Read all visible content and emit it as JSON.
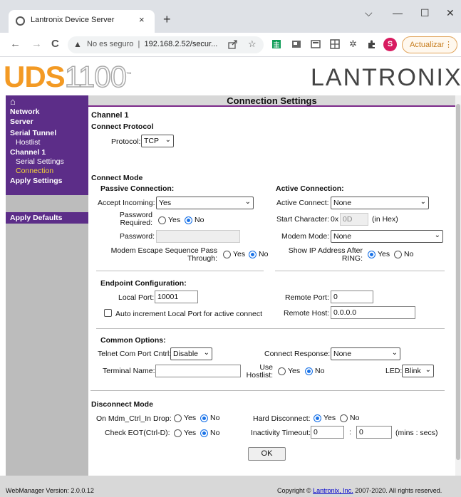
{
  "browser": {
    "tab_title": "Lantronix Device Server",
    "tab_close": "×",
    "new_tab": "+",
    "win_min": "—",
    "win_max": "☐",
    "win_close": "✕",
    "win_chev": "⌵",
    "back": "←",
    "forward": "→",
    "reload": "C",
    "warn": "▲",
    "security_text": "No es seguro",
    "url": "192.168.2.52/secur...",
    "avatar": "S",
    "update_label": "Actualizar",
    "menu": "⋮"
  },
  "banner": {
    "model_prefix": "UDS",
    "model_num": "1100",
    "brand": "LANTRONIX"
  },
  "sidebar": {
    "home_icon": "⌂",
    "items": [
      "Network",
      "Server",
      "Serial Tunnel",
      "Hostlist",
      "Channel 1",
      "Serial Settings",
      "Connection",
      "Apply Settings"
    ],
    "apply_defaults": "Apply Defaults"
  },
  "page": {
    "title": "Connection Settings",
    "channel": "Channel 1",
    "connect_protocol": "Connect Protocol",
    "protocol_label": "Protocol:",
    "protocol_value": "TCP",
    "connect_mode": "Connect Mode",
    "passive": "Passive Connection:",
    "active": "Active Connection:",
    "accept_incoming_label": "Accept Incoming:",
    "accept_incoming_value": "Yes",
    "password_required_l1": "Password",
    "password_required_l2": "Required:",
    "password_label": "Password:",
    "password_value": "",
    "modem_escape_l1": "Modem Escape Sequence Pass",
    "modem_escape_l2": "Through:",
    "active_connect_label": "Active Connect:",
    "active_connect_value": "None",
    "start_char_label": "Start Character:",
    "start_char_prefix": "0x",
    "start_char_value": "0D",
    "start_char_suffix": "(in Hex)",
    "modem_mode_label": "Modem Mode:",
    "modem_mode_value": "None",
    "show_ip_l1": "Show IP Address After",
    "show_ip_l2": "RING:",
    "yes": "Yes",
    "no": "No",
    "endpoint": "Endpoint Configuration:",
    "local_port_label": "Local Port:",
    "local_port_value": "10001",
    "auto_increment": "Auto increment Local Port for active connect",
    "remote_port_label": "Remote Port:",
    "remote_port_value": "0",
    "remote_host_label": "Remote Host:",
    "remote_host_value": "0.0.0.0",
    "common": "Common Options:",
    "telnet_label": "Telnet Com Port Cntrl:",
    "telnet_value": "Disable",
    "connect_response_label": "Connect Response:",
    "connect_response_value": "None",
    "terminal_name_label": "Terminal Name:",
    "terminal_name_value": "",
    "use_hostlist_l1": "Use",
    "use_hostlist_l2": "Hostlist:",
    "led_label": "LED:",
    "led_value": "Blink",
    "disconnect_mode": "Disconnect Mode",
    "on_mdm_label": "On Mdm_Ctrl_In Drop:",
    "hard_disconnect_label": "Hard Disconnect:",
    "check_eot_label": "Check EOT(Ctrl-D):",
    "inactivity_label": "Inactivity Timeout:",
    "inactivity_min": "0",
    "inactivity_sep": ":",
    "inactivity_sec": "0",
    "inactivity_units": "(mins : secs)",
    "ok": "OK"
  },
  "footer": {
    "version": "WebManager Version: 2.0.0.12",
    "copy_pre": "Copyright © ",
    "copy_link": "Lantronix, Inc.",
    "copy_post": " 2007-2020. All rights reserved."
  }
}
